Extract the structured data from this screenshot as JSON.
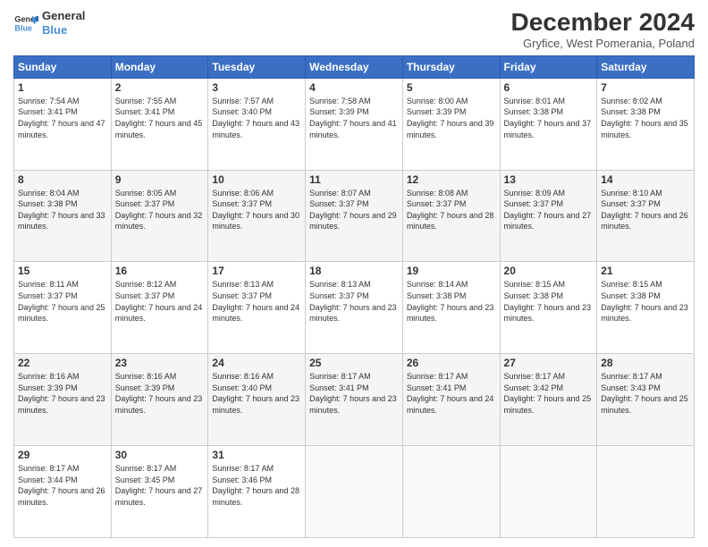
{
  "logo": {
    "line1": "General",
    "line2": "Blue"
  },
  "title": "December 2024",
  "subtitle": "Gryfice, West Pomerania, Poland",
  "days_header": [
    "Sunday",
    "Monday",
    "Tuesday",
    "Wednesday",
    "Thursday",
    "Friday",
    "Saturday"
  ],
  "weeks": [
    [
      {
        "day": "1",
        "info": "Sunrise: 7:54 AM\nSunset: 3:41 PM\nDaylight: 7 hours and 47 minutes."
      },
      {
        "day": "2",
        "info": "Sunrise: 7:55 AM\nSunset: 3:41 PM\nDaylight: 7 hours and 45 minutes."
      },
      {
        "day": "3",
        "info": "Sunrise: 7:57 AM\nSunset: 3:40 PM\nDaylight: 7 hours and 43 minutes."
      },
      {
        "day": "4",
        "info": "Sunrise: 7:58 AM\nSunset: 3:39 PM\nDaylight: 7 hours and 41 minutes."
      },
      {
        "day": "5",
        "info": "Sunrise: 8:00 AM\nSunset: 3:39 PM\nDaylight: 7 hours and 39 minutes."
      },
      {
        "day": "6",
        "info": "Sunrise: 8:01 AM\nSunset: 3:38 PM\nDaylight: 7 hours and 37 minutes."
      },
      {
        "day": "7",
        "info": "Sunrise: 8:02 AM\nSunset: 3:38 PM\nDaylight: 7 hours and 35 minutes."
      }
    ],
    [
      {
        "day": "8",
        "info": "Sunrise: 8:04 AM\nSunset: 3:38 PM\nDaylight: 7 hours and 33 minutes."
      },
      {
        "day": "9",
        "info": "Sunrise: 8:05 AM\nSunset: 3:37 PM\nDaylight: 7 hours and 32 minutes."
      },
      {
        "day": "10",
        "info": "Sunrise: 8:06 AM\nSunset: 3:37 PM\nDaylight: 7 hours and 30 minutes."
      },
      {
        "day": "11",
        "info": "Sunrise: 8:07 AM\nSunset: 3:37 PM\nDaylight: 7 hours and 29 minutes."
      },
      {
        "day": "12",
        "info": "Sunrise: 8:08 AM\nSunset: 3:37 PM\nDaylight: 7 hours and 28 minutes."
      },
      {
        "day": "13",
        "info": "Sunrise: 8:09 AM\nSunset: 3:37 PM\nDaylight: 7 hours and 27 minutes."
      },
      {
        "day": "14",
        "info": "Sunrise: 8:10 AM\nSunset: 3:37 PM\nDaylight: 7 hours and 26 minutes."
      }
    ],
    [
      {
        "day": "15",
        "info": "Sunrise: 8:11 AM\nSunset: 3:37 PM\nDaylight: 7 hours and 25 minutes."
      },
      {
        "day": "16",
        "info": "Sunrise: 8:12 AM\nSunset: 3:37 PM\nDaylight: 7 hours and 24 minutes."
      },
      {
        "day": "17",
        "info": "Sunrise: 8:13 AM\nSunset: 3:37 PM\nDaylight: 7 hours and 24 minutes."
      },
      {
        "day": "18",
        "info": "Sunrise: 8:13 AM\nSunset: 3:37 PM\nDaylight: 7 hours and 23 minutes."
      },
      {
        "day": "19",
        "info": "Sunrise: 8:14 AM\nSunset: 3:38 PM\nDaylight: 7 hours and 23 minutes."
      },
      {
        "day": "20",
        "info": "Sunrise: 8:15 AM\nSunset: 3:38 PM\nDaylight: 7 hours and 23 minutes."
      },
      {
        "day": "21",
        "info": "Sunrise: 8:15 AM\nSunset: 3:38 PM\nDaylight: 7 hours and 23 minutes."
      }
    ],
    [
      {
        "day": "22",
        "info": "Sunrise: 8:16 AM\nSunset: 3:39 PM\nDaylight: 7 hours and 23 minutes."
      },
      {
        "day": "23",
        "info": "Sunrise: 8:16 AM\nSunset: 3:39 PM\nDaylight: 7 hours and 23 minutes."
      },
      {
        "day": "24",
        "info": "Sunrise: 8:16 AM\nSunset: 3:40 PM\nDaylight: 7 hours and 23 minutes."
      },
      {
        "day": "25",
        "info": "Sunrise: 8:17 AM\nSunset: 3:41 PM\nDaylight: 7 hours and 23 minutes."
      },
      {
        "day": "26",
        "info": "Sunrise: 8:17 AM\nSunset: 3:41 PM\nDaylight: 7 hours and 24 minutes."
      },
      {
        "day": "27",
        "info": "Sunrise: 8:17 AM\nSunset: 3:42 PM\nDaylight: 7 hours and 25 minutes."
      },
      {
        "day": "28",
        "info": "Sunrise: 8:17 AM\nSunset: 3:43 PM\nDaylight: 7 hours and 25 minutes."
      }
    ],
    [
      {
        "day": "29",
        "info": "Sunrise: 8:17 AM\nSunset: 3:44 PM\nDaylight: 7 hours and 26 minutes."
      },
      {
        "day": "30",
        "info": "Sunrise: 8:17 AM\nSunset: 3:45 PM\nDaylight: 7 hours and 27 minutes."
      },
      {
        "day": "31",
        "info": "Sunrise: 8:17 AM\nSunset: 3:46 PM\nDaylight: 7 hours and 28 minutes."
      },
      null,
      null,
      null,
      null
    ]
  ]
}
